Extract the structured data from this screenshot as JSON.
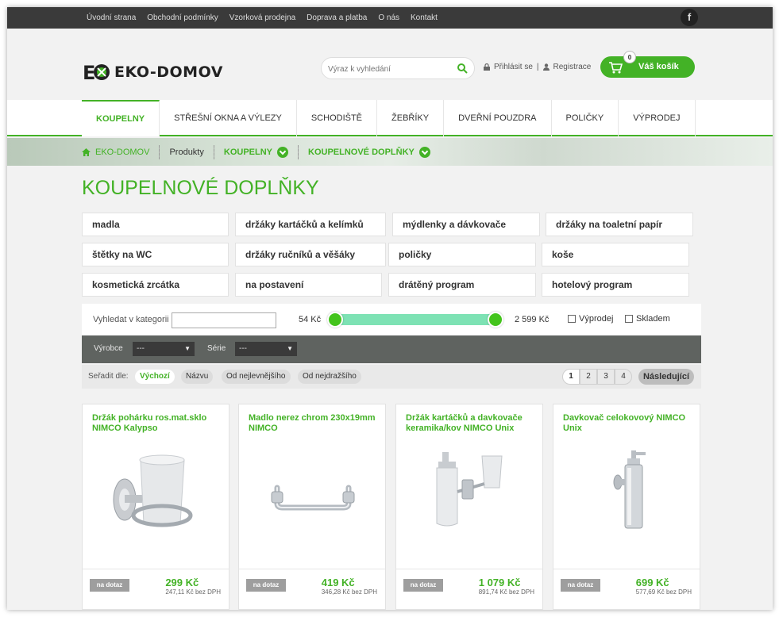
{
  "topnav": {
    "items": [
      "Úvodní strana",
      "Obchodní podmínky",
      "Vzorková prodejna",
      "Doprava a platba",
      "O nás",
      "Kontakt"
    ],
    "facebook": "f"
  },
  "header": {
    "logo_text": "EKO-DOMOV",
    "search_placeholder": "Výraz k vyhledání",
    "login": "Přihlásit se",
    "separator": "|",
    "register": "Registrace",
    "cart_count": "0",
    "cart_label": "Váš košík"
  },
  "mainnav": {
    "tabs": [
      "KOUPELNY",
      "STŘEŠNÍ OKNA A VÝLEZY",
      "SCHODIŠTĚ",
      "ŽEBŘÍKY",
      "DVEŘNÍ POUZDRA",
      "POLIČKY",
      "VÝPRODEJ"
    ]
  },
  "breadcrumb": {
    "home": "EKO-DOMOV",
    "products": "Produkty",
    "bathrooms": "KOUPELNY",
    "current": "KOUPELNOVÉ DOPLŇKY"
  },
  "page_title": "KOUPELNOVÉ DOPLŇKY",
  "categories": [
    "madla",
    "držáky kartáčků a kelímků",
    "mýdlenky a dávkovače",
    "držáky na toaletní papír",
    "štětky na WC",
    "držáky ručníků a věšáky",
    "poličky",
    "koše",
    "kosmetická zrcátka",
    "na postavení",
    "drátěný program",
    "hotelový program"
  ],
  "filter": {
    "search_label": "Vyhledat v kategorii",
    "price_min": "54 Kč",
    "price_max": "2 599 Kč",
    "sale_label": "Výprodej",
    "stock_label": "Skladem",
    "manufacturer_label": "Výrobce",
    "manufacturer_value": "---",
    "series_label": "Série",
    "series_value": "---"
  },
  "sort": {
    "label": "Seřadit dle:",
    "options": [
      "Výchozí",
      "Názvu",
      "Od nejlevnějšího",
      "Od nejdražšího"
    ],
    "pages": [
      "1",
      "2",
      "3",
      "4"
    ],
    "next": "Následující"
  },
  "products": [
    {
      "name": "Držák pohárku ros.mat.sklo NIMCO Kalypso",
      "button": "na dotaz",
      "price": "299 Kč",
      "price_ex_vat": "247,11 Kč bez DPH"
    },
    {
      "name": "Madlo nerez chrom 230x19mm NIMCO",
      "button": "na dotaz",
      "price": "419 Kč",
      "price_ex_vat": "346,28 Kč bez DPH"
    },
    {
      "name": "Držák kartáčků a davkovače keramika/kov NIMCO Unix",
      "button": "na dotaz",
      "price": "1 079 Kč",
      "price_ex_vat": "891,74 Kč bez DPH"
    },
    {
      "name": "Davkovač celokovový NIMCO Unix",
      "button": "na dotaz",
      "price": "699 Kč",
      "price_ex_vat": "577,69 Kč bez DPH"
    }
  ],
  "colors": {
    "accent": "#43b226",
    "topbar": "#3a3a3a",
    "darkbar": "#5f6360"
  }
}
